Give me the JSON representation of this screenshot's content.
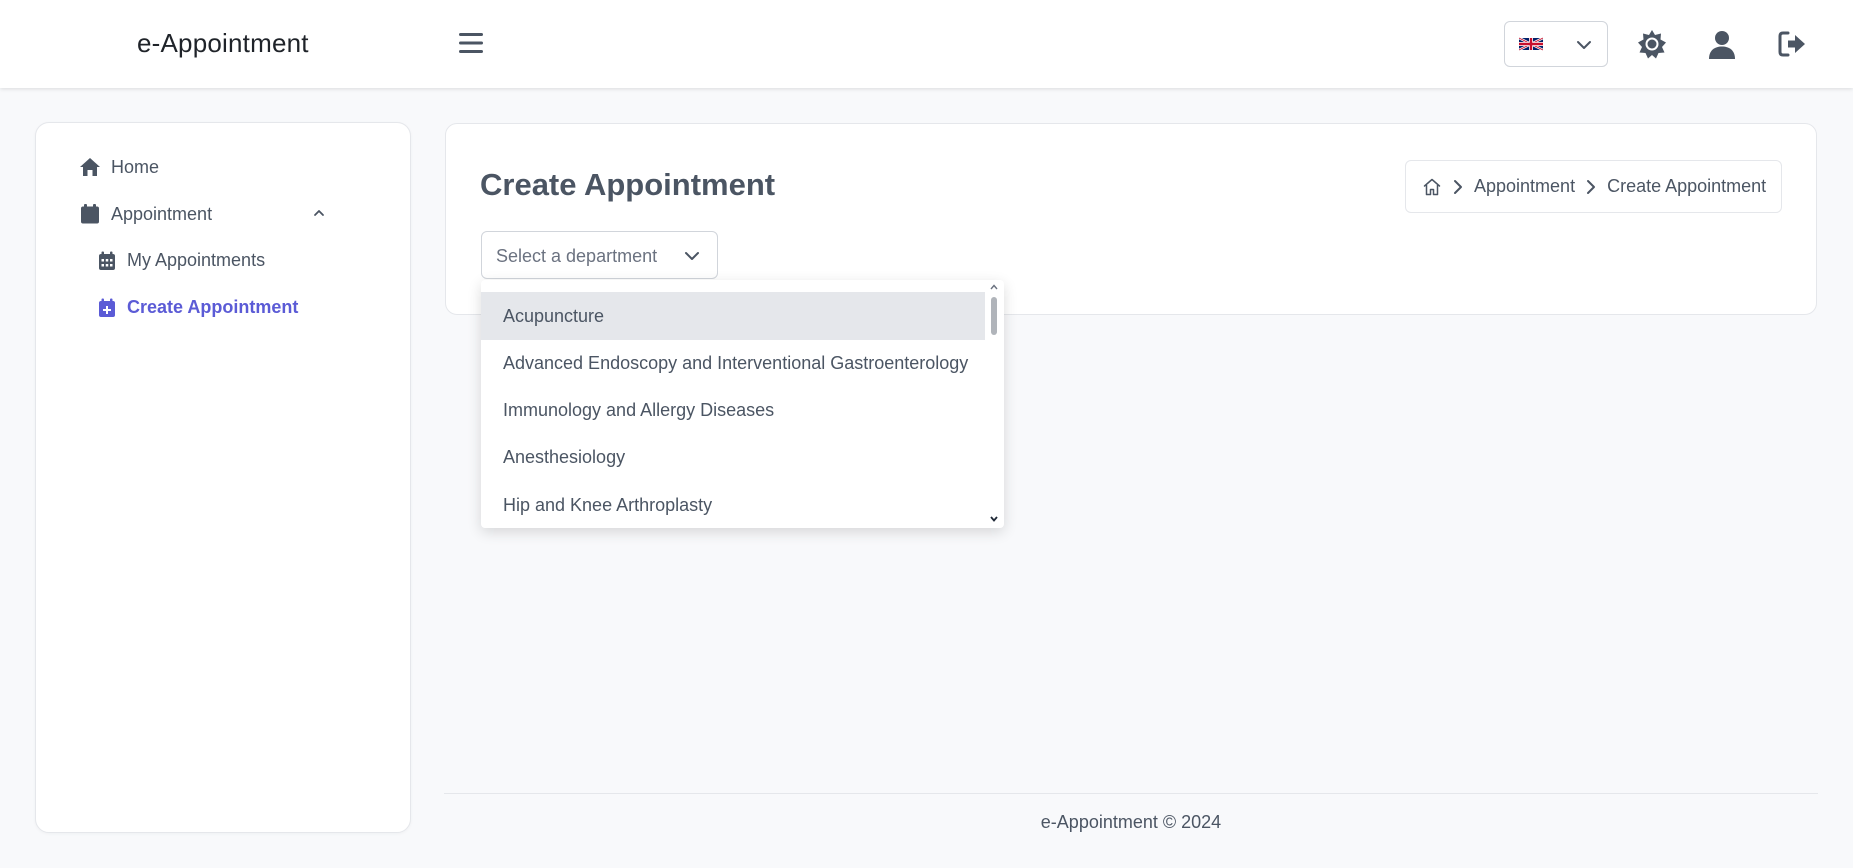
{
  "header": {
    "brand": "e-Appointment",
    "language": "English (UK)"
  },
  "sidebar": {
    "items": [
      {
        "label": "Home",
        "icon": "home-icon"
      },
      {
        "label": "Appointment",
        "icon": "calendar-icon",
        "expanded": true
      },
      {
        "label": "My Appointments",
        "icon": "calendar-grid-icon"
      },
      {
        "label": "Create Appointment",
        "icon": "calendar-plus-icon",
        "active": true
      }
    ]
  },
  "main": {
    "title": "Create Appointment",
    "breadcrumb": [
      "Appointment",
      "Create Appointment"
    ],
    "department_select": {
      "placeholder": "Select a department",
      "options": [
        "Acupuncture",
        "Advanced Endoscopy and Interventional Gastroenterology",
        "Immunology and Allergy Diseases",
        "Anesthesiology",
        "Hip and Knee Arthroplasty"
      ],
      "highlighted": "Acupuncture"
    }
  },
  "footer": {
    "text": "e-Appointment © 2024"
  },
  "colors": {
    "accent": "#5b5bd6",
    "text": "#4b5563",
    "background": "#f8f9fb",
    "highlight": "#e5e7eb"
  }
}
